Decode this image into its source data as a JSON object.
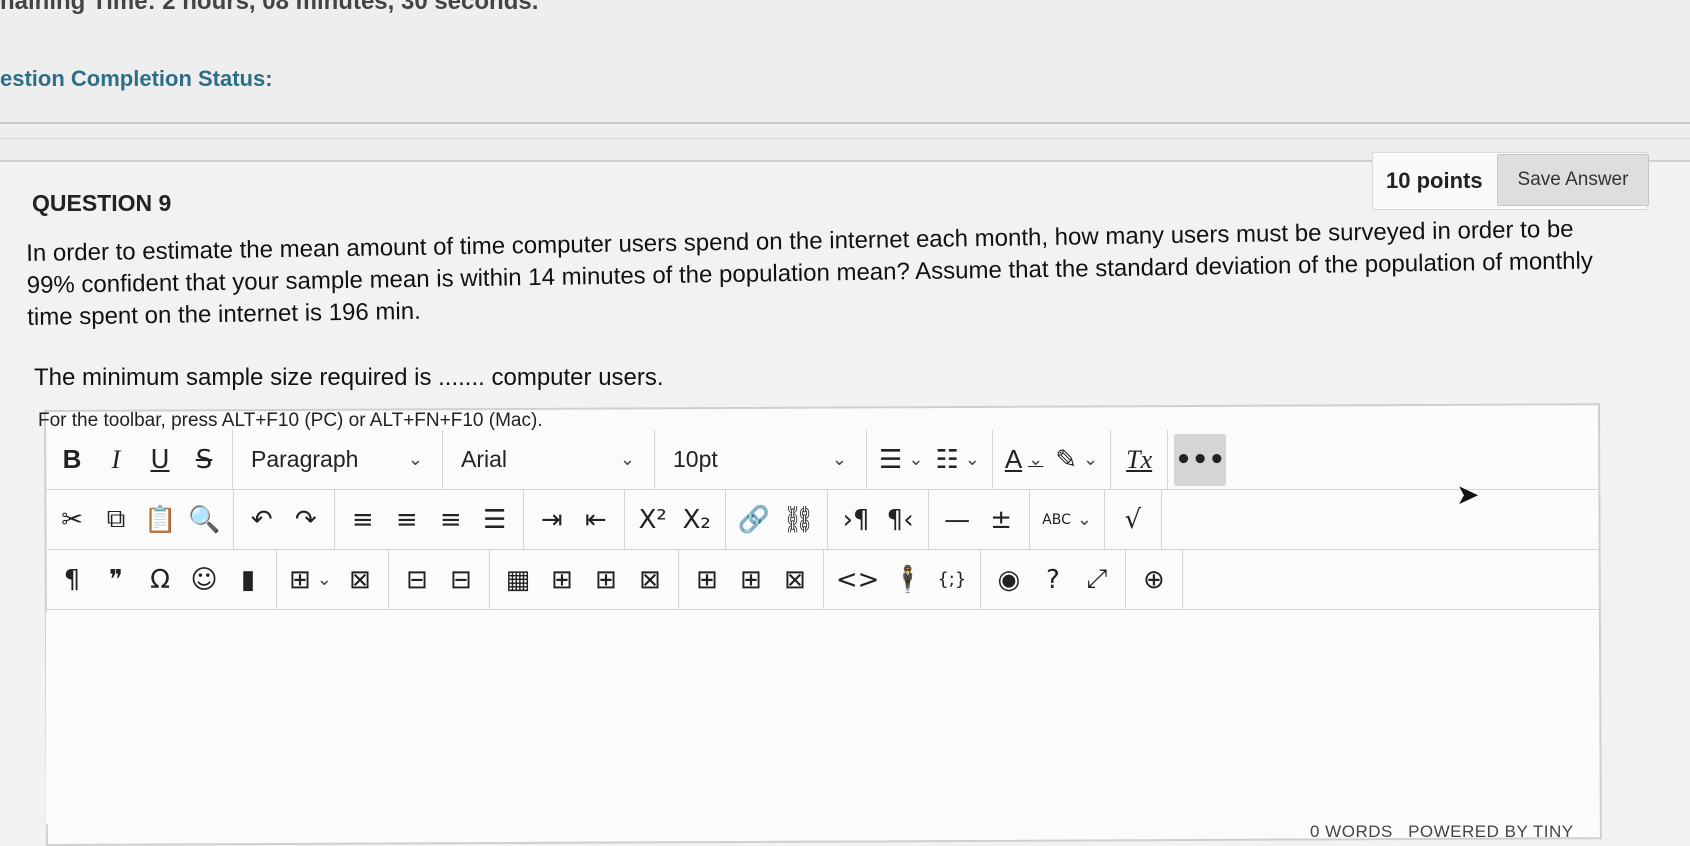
{
  "header": {
    "remaining_time": "naining Time: 2 hours, 08 minutes, 30 seconds.",
    "completion_status_label": "estion Completion Status:"
  },
  "question": {
    "title": "QUESTION 9",
    "points": "10 points",
    "save_label": "Save Answer",
    "text": "In order to estimate the mean amount of time computer users spend on the internet each month, how many users must be surveyed in order to be 99% confident that your sample mean is within 14 minutes of the population mean? Assume that the standard deviation of the population of monthly time spent on the internet is 196 min.",
    "prompt": "The minimum sample size required is ....... computer users."
  },
  "editor": {
    "toolbar_hint": "For the toolbar, press ALT+F10 (PC) or ALT+FN+F10 (Mac).",
    "block_format": "Paragraph",
    "font_family": "Arial",
    "font_size": "10pt",
    "word_count": "0 WORDS",
    "powered_by": "POWERED BY TINY"
  },
  "icons": {
    "bold": "B",
    "italic": "I",
    "underline": "U",
    "strikethrough": "S",
    "text_color": "A",
    "clear_formatting": "Tx",
    "more": "•••",
    "superscript": "X²",
    "subscript": "X₂",
    "paragraph_mark": "¶",
    "blockquote": "❞",
    "special_char": "Ω",
    "emoticon": "☺",
    "codesample": "{;}",
    "code": "<>",
    "spellcheck": "ABC"
  }
}
